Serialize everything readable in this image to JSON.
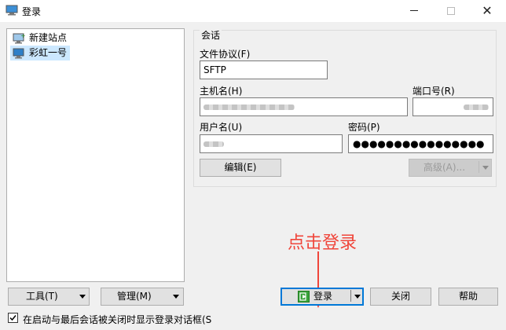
{
  "window": {
    "title": "登录",
    "minimize_label": "—",
    "maximize_label": "☐",
    "close_label": "✕"
  },
  "sites": {
    "items": [
      {
        "label": "新建站点",
        "selected": false
      },
      {
        "label": "彩虹一号",
        "selected": true
      }
    ]
  },
  "session": {
    "group_title": "会话",
    "protocol_label": "文件协议(F)",
    "protocol_value": "SFTP",
    "host_label": "主机名(H)",
    "port_label": "端口号(R)",
    "user_label": "用户名(U)",
    "password_label": "密码(P)",
    "password_value": "●●●●●●●●●●●●●●●●",
    "edit_button": "编辑(E)",
    "advanced_button": "高级(A)..."
  },
  "bottom": {
    "tools_button": "工具(T)",
    "manage_button": "管理(M)",
    "login_button": "登录",
    "close_button": "关闭",
    "help_button": "帮助",
    "checkbox_label": "在启动与最后会话被关闭时显示登录对话框(S",
    "checkbox_checked": true
  },
  "annotation": {
    "text": "点击登录",
    "color": "#f0453a"
  },
  "colors": {
    "selection": "#cce8ff",
    "focus_border": "#0078d7",
    "dialog_bg": "#f0f0f0"
  }
}
